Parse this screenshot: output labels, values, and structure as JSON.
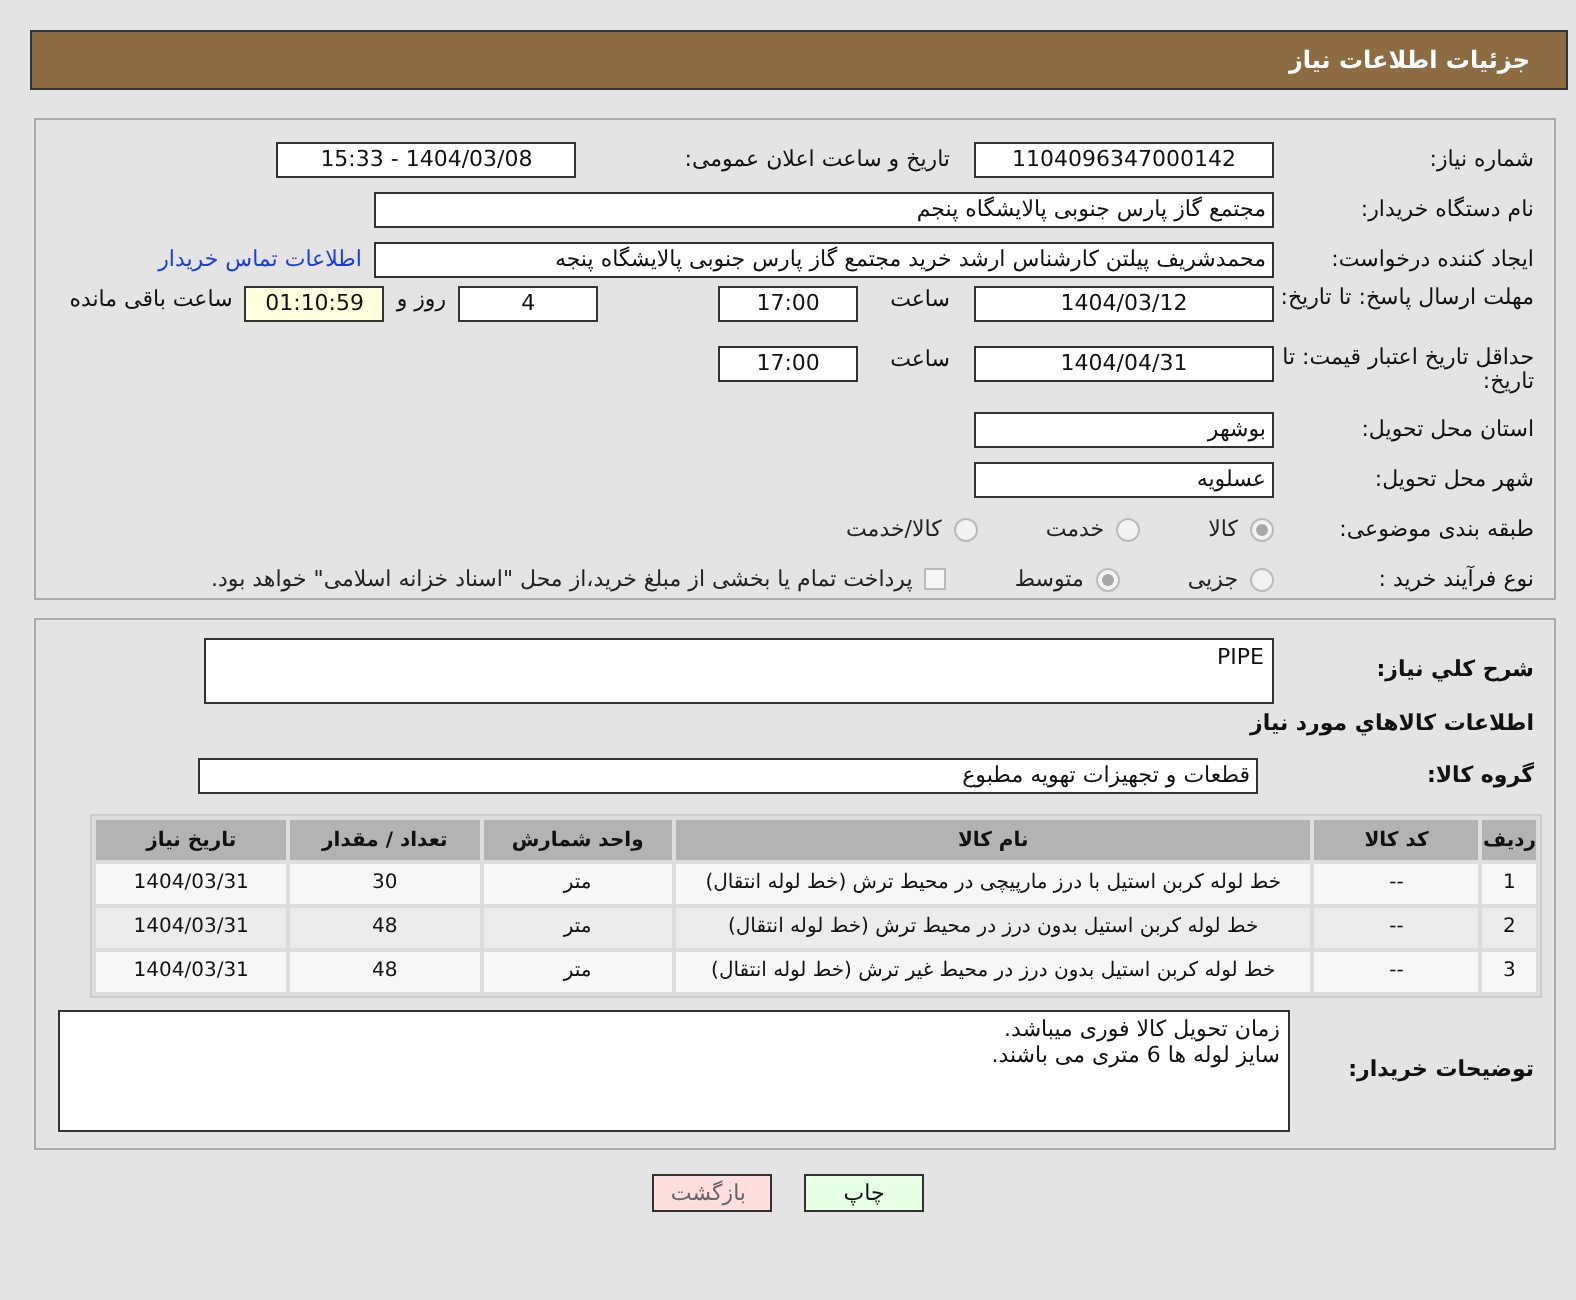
{
  "header": {
    "title": "جزئیات اطلاعات نیاز"
  },
  "need_number": {
    "label": "شماره نیاز:",
    "value": "1104096347000142"
  },
  "announce": {
    "label": "تاریخ و ساعت اعلان عمومی:",
    "value": "1404/03/08 - 15:33"
  },
  "buyer_org": {
    "label": "نام دستگاه خریدار:",
    "value": "مجتمع گاز پارس جنوبی  پالایشگاه پنجم"
  },
  "requester": {
    "label": "ایجاد کننده درخواست:",
    "value": "محمدشریف پیلتن کارشناس ارشد خرید مجتمع گاز پارس جنوبی  پالایشگاه پنجه",
    "link": "اطلاعات تماس خریدار"
  },
  "reply_deadline": {
    "label": "مهلت ارسال پاسخ: تا تاریخ:",
    "date": "1404/03/12",
    "time_label": "ساعت",
    "time": "17:00",
    "days": "4",
    "days_label": "روز و",
    "remaining": "01:10:59",
    "remaining_label": "ساعت باقی مانده"
  },
  "price_validity": {
    "label": "حداقل تاریخ اعتبار قیمت: تا تاریخ:",
    "date": "1404/04/31",
    "time_label": "ساعت",
    "time": "17:00"
  },
  "province": {
    "label": "استان محل تحویل:",
    "value": "بوشهر"
  },
  "city": {
    "label": "شهر محل تحویل:",
    "value": "عسلویه"
  },
  "category": {
    "label": "طبقه بندی موضوعی:",
    "options": [
      {
        "label": "کالا",
        "selected": true
      },
      {
        "label": "خدمت",
        "selected": false
      },
      {
        "label": "کالا/خدمت",
        "selected": false
      }
    ]
  },
  "process": {
    "label": "نوع فرآیند خرید :",
    "options": [
      {
        "label": "جزیی",
        "selected": false
      },
      {
        "label": "متوسط",
        "selected": true
      }
    ],
    "payment": {
      "label": "پرداخت تمام یا بخشی از مبلغ خرید،از محل \"اسناد خزانه اسلامی\" خواهد بود.",
      "checked": false
    }
  },
  "description": {
    "label": "شرح کلي نياز:",
    "value": "PIPE"
  },
  "goods_title": "اطلاعات کالاهاي مورد نياز",
  "goods_group": {
    "label": "گروه کالا:",
    "value": "قطعات و تجهیزات تهویه مطبوع"
  },
  "table": {
    "columns": [
      "ردیف",
      "کد کالا",
      "نام کالا",
      "واحد شمارش",
      "تعداد / مقدار",
      "تاریخ نیاز"
    ],
    "rows": [
      [
        "1",
        "--",
        "خط لوله کربن استیل با درز مارپیچی در محیط ترش (خط لوله انتقال)",
        "متر",
        "30",
        "1404/03/31"
      ],
      [
        "2",
        "--",
        "خط لوله کربن استیل بدون درز در محیط ترش (خط لوله انتقال)",
        "متر",
        "48",
        "1404/03/31"
      ],
      [
        "3",
        "--",
        "خط لوله کربن استیل بدون درز در محیط غیر ترش (خط لوله انتقال)",
        "متر",
        "48",
        "1404/03/31"
      ]
    ]
  },
  "buyer_notes": {
    "label": "توضیحات خریدار:",
    "lines": [
      "زمان تحویل کالا فوری میباشد.",
      "سایز لوله ها 6 متری می باشند."
    ]
  },
  "buttons": [
    {
      "label": "چاپ",
      "kind": "print"
    },
    {
      "label": "بازگشت",
      "kind": "back"
    }
  ]
}
